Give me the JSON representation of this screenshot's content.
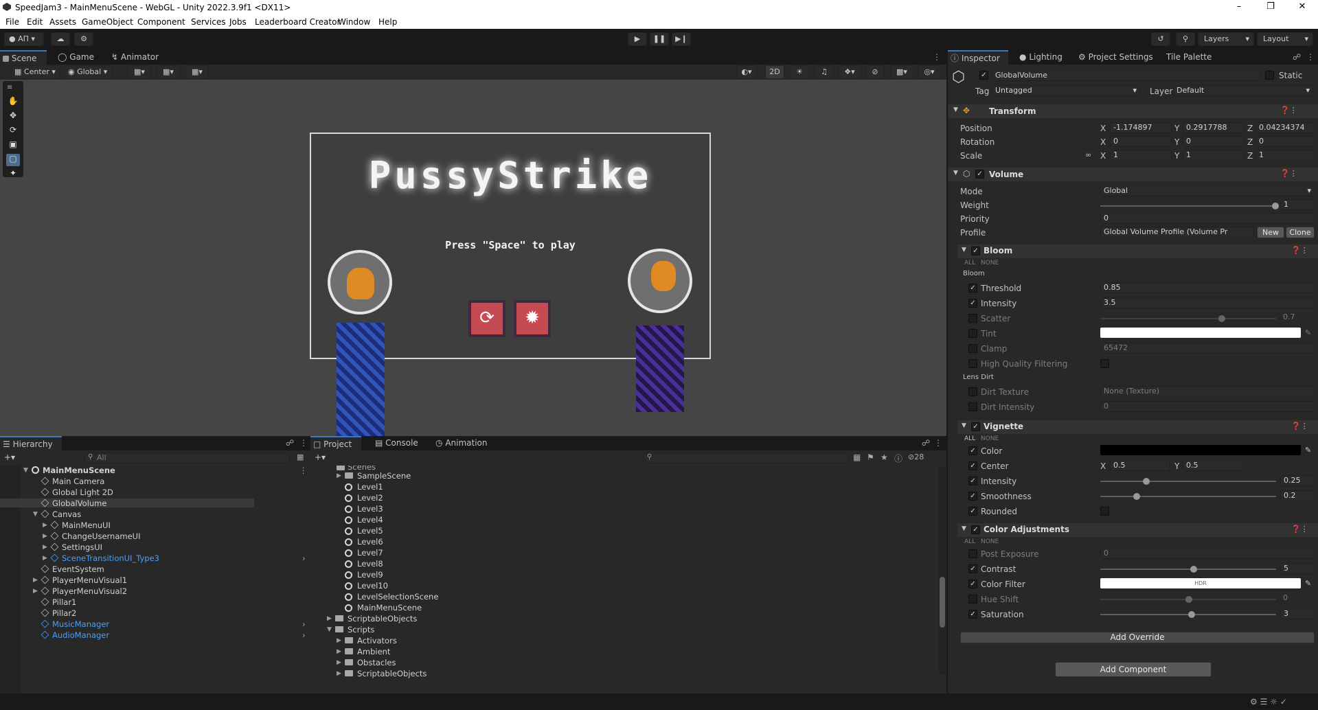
{
  "window": {
    "title": "SpeedJam3 - MainMenuScene - WebGL - Unity 2022.3.9f1 <DX11>"
  },
  "menu": [
    "File",
    "Edit",
    "Assets",
    "GameObject",
    "Component",
    "Services",
    "Jobs",
    "Leaderboard Creator",
    "Window",
    "Help"
  ],
  "toolbar": {
    "account": "АП",
    "layers": "Layers",
    "layout": "Layout"
  },
  "scene_tabs": [
    "Scene",
    "Game",
    "Animator"
  ],
  "scene_toolbar": {
    "pivot": "Center",
    "space": "Global",
    "mode2d": "2D"
  },
  "game": {
    "title": "PussyStrike",
    "prompt": "Press \"Space\" to play"
  },
  "hierarchy": {
    "tab": "Hierarchy",
    "search_placeholder": "All",
    "items": [
      {
        "label": "MainMenuScene",
        "indent": 0,
        "kind": "scene",
        "expanded": true
      },
      {
        "label": "Main Camera",
        "indent": 1,
        "kind": "go"
      },
      {
        "label": "Global Light 2D",
        "indent": 1,
        "kind": "go"
      },
      {
        "label": "GlobalVolume",
        "indent": 1,
        "kind": "go",
        "selected": true
      },
      {
        "label": "Canvas",
        "indent": 1,
        "kind": "go",
        "expanded": true
      },
      {
        "label": "MainMenuUI",
        "indent": 2,
        "kind": "go",
        "collapsed": true
      },
      {
        "label": "ChangeUsernameUI",
        "indent": 2,
        "kind": "go",
        "collapsed": true
      },
      {
        "label": "SettingsUI",
        "indent": 2,
        "kind": "go",
        "collapsed": true
      },
      {
        "label": "SceneTransitionUI_Type3",
        "indent": 2,
        "kind": "prefab",
        "collapsed": true
      },
      {
        "label": "EventSystem",
        "indent": 1,
        "kind": "go"
      },
      {
        "label": "PlayerMenuVisual1",
        "indent": 1,
        "kind": "go",
        "collapsed": true
      },
      {
        "label": "PlayerMenuVisual2",
        "indent": 1,
        "kind": "go",
        "collapsed": true
      },
      {
        "label": "Pillar1",
        "indent": 1,
        "kind": "go"
      },
      {
        "label": "Pillar2",
        "indent": 1,
        "kind": "go"
      },
      {
        "label": "MusicManager",
        "indent": 1,
        "kind": "prefab"
      },
      {
        "label": "AudioManager",
        "indent": 1,
        "kind": "prefab"
      }
    ]
  },
  "project": {
    "tabs": [
      "Project",
      "Console",
      "Animation"
    ],
    "hidden_count": "28",
    "partial_top": "Scenes",
    "items": [
      {
        "label": "SampleScene",
        "indent": 2,
        "kind": "folder",
        "collapsed": true
      },
      {
        "label": "Level1",
        "indent": 2,
        "kind": "scene"
      },
      {
        "label": "Level2",
        "indent": 2,
        "kind": "scene"
      },
      {
        "label": "Level3",
        "indent": 2,
        "kind": "scene"
      },
      {
        "label": "Level4",
        "indent": 2,
        "kind": "scene"
      },
      {
        "label": "Level5",
        "indent": 2,
        "kind": "scene"
      },
      {
        "label": "Level6",
        "indent": 2,
        "kind": "scene"
      },
      {
        "label": "Level7",
        "indent": 2,
        "kind": "scene"
      },
      {
        "label": "Level8",
        "indent": 2,
        "kind": "scene"
      },
      {
        "label": "Level9",
        "indent": 2,
        "kind": "scene"
      },
      {
        "label": "Level10",
        "indent": 2,
        "kind": "scene"
      },
      {
        "label": "LevelSelectionScene",
        "indent": 2,
        "kind": "scene"
      },
      {
        "label": "MainMenuScene",
        "indent": 2,
        "kind": "scene"
      },
      {
        "label": "ScriptableObjects",
        "indent": 1,
        "kind": "folder",
        "collapsed": true
      },
      {
        "label": "Scripts",
        "indent": 1,
        "kind": "folder",
        "expanded": true
      },
      {
        "label": "Activators",
        "indent": 2,
        "kind": "folder",
        "collapsed": true
      },
      {
        "label": "Ambient",
        "indent": 2,
        "kind": "folder",
        "collapsed": true
      },
      {
        "label": "Obstacles",
        "indent": 2,
        "kind": "folder",
        "collapsed": true
      },
      {
        "label": "ScriptableObjects",
        "indent": 2,
        "kind": "folder",
        "collapsed": true
      }
    ]
  },
  "inspector": {
    "tabs": [
      "Inspector",
      "Lighting",
      "Project Settings",
      "Tile Palette"
    ],
    "object_name": "GlobalVolume",
    "static_label": "Static",
    "tag_label": "Tag",
    "tag_value": "Untagged",
    "layer_label": "Layer",
    "layer_value": "Default",
    "transform": {
      "title": "Transform",
      "position": {
        "label": "Position",
        "x": "-1.174897",
        "y": "0.2917788",
        "z": "0.04234374"
      },
      "rotation": {
        "label": "Rotation",
        "x": "0",
        "y": "0",
        "z": "0"
      },
      "scale": {
        "label": "Scale",
        "x": "1",
        "y": "1",
        "z": "1"
      }
    },
    "volume": {
      "title": "Volume",
      "mode_label": "Mode",
      "mode": "Global",
      "weight_label": "Weight",
      "weight": "1",
      "priority_label": "Priority",
      "priority": "0",
      "profile_label": "Profile",
      "profile": "Global Volume Profile (Volume Pr",
      "new_label": "New",
      "clone_label": "Clone"
    },
    "all_label": "ALL",
    "none_label": "NONE",
    "bloom": {
      "title": "Bloom",
      "group": "Bloom",
      "threshold_label": "Threshold",
      "threshold": "0.85",
      "intensity_label": "Intensity",
      "intensity": "3.5",
      "scatter_label": "Scatter",
      "scatter": "0.7",
      "tint_label": "Tint",
      "clamp_label": "Clamp",
      "clamp": "65472",
      "hq_label": "High Quality Filtering",
      "lens_dirt": "Lens Dirt",
      "dirt_texture_label": "Dirt Texture",
      "dirt_texture": "None (Texture)",
      "dirt_intensity_label": "Dirt Intensity",
      "dirt_intensity": "0"
    },
    "vignette": {
      "title": "Vignette",
      "color_label": "Color",
      "center_label": "Center",
      "center_x": "0.5",
      "center_y": "0.5",
      "intensity_label": "Intensity",
      "intensity": "0.25",
      "smoothness_label": "Smoothness",
      "smoothness": "0.2",
      "rounded_label": "Rounded"
    },
    "color_adjustments": {
      "title": "Color Adjustments",
      "post_exposure_label": "Post Exposure",
      "post_exposure": "0",
      "contrast_label": "Contrast",
      "contrast": "5",
      "color_filter_label": "Color Filter",
      "hdr": "HDR",
      "hue_shift_label": "Hue Shift",
      "hue_shift": "0",
      "saturation_label": "Saturation",
      "saturation": "3"
    },
    "add_override": "Add Override",
    "add_component": "Add Component"
  }
}
